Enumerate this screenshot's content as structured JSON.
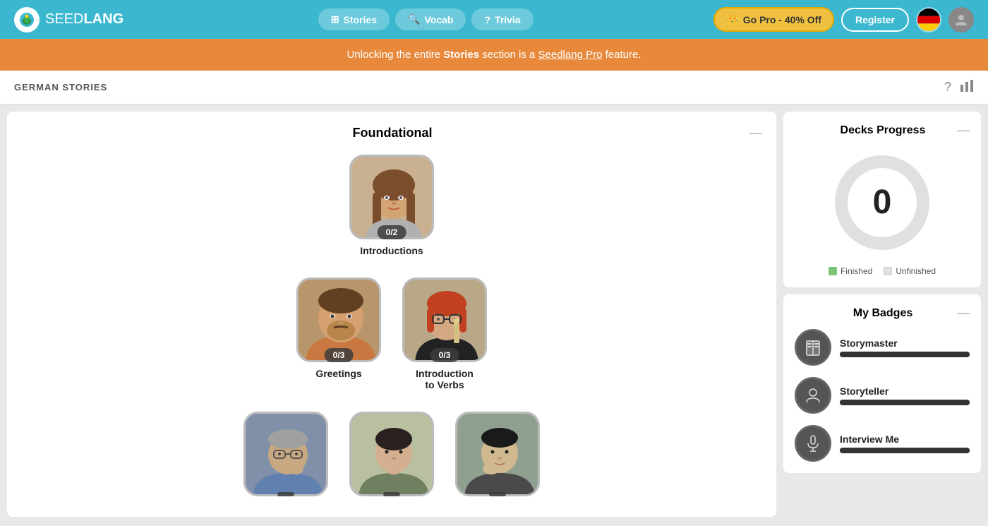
{
  "header": {
    "logo_text_light": "SEED",
    "logo_text_bold": "LANG",
    "nav": {
      "stories_label": "Stories",
      "vocab_label": "Vocab",
      "trivia_label": "Trivia"
    },
    "go_pro_label": "Go Pro - 40% Off",
    "register_label": "Register"
  },
  "banner": {
    "text_before": "Unlocking the entire ",
    "highlight": "Stories",
    "text_middle": " section is a ",
    "link_text": "Seedlang Pro",
    "text_after": " feature."
  },
  "page_header": {
    "title": "GERMAN STORIES"
  },
  "stories": {
    "section_title": "Foundational",
    "collapse_label": "—",
    "cards": [
      {
        "label": "Introductions",
        "badge": "0/2",
        "row": 1
      },
      {
        "label": "Greetings",
        "badge": "0/3",
        "row": 2
      },
      {
        "label": "Introduction\nto Verbs",
        "badge": "0/3",
        "row": 2
      },
      {
        "label": "",
        "badge": "",
        "row": 3
      },
      {
        "label": "",
        "badge": "",
        "row": 3
      },
      {
        "label": "",
        "badge": "",
        "row": 3
      }
    ]
  },
  "decks_progress": {
    "title": "Decks Progress",
    "value": "0",
    "legend": {
      "finished_label": "Finished",
      "unfinished_label": "Unfinished"
    }
  },
  "badges": {
    "title": "My Badges",
    "items": [
      {
        "name": "Storymaster",
        "icon": "📖"
      },
      {
        "name": "Storyteller",
        "icon": "👤"
      },
      {
        "name": "Interview Me",
        "icon": "🎤"
      }
    ]
  }
}
